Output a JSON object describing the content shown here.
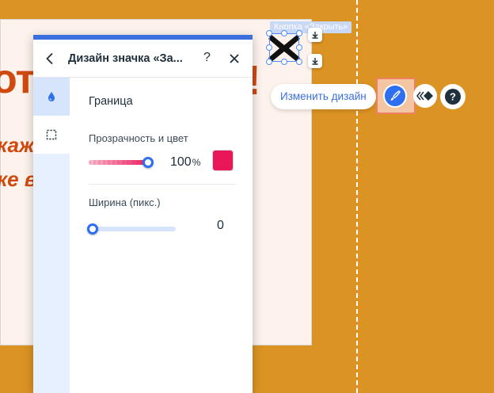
{
  "canvas": {
    "headline_fragment": "от",
    "headline_end": "!",
    "line1_fragment": "каж",
    "line2_fragment": "ке в"
  },
  "selected_element": {
    "tag_label": "Кнопка «Закрыть»"
  },
  "floating_toolbar": {
    "change_design_label": "Изменить дизайн",
    "help_label": "?"
  },
  "panel": {
    "title": "Дизайн значка «За...",
    "help_label": "?",
    "section_title": "Граница",
    "opacity": {
      "label": "Прозрачность и цвет",
      "value": "100",
      "unit": "%",
      "level": 1.0,
      "color": "#e9165a"
    },
    "width": {
      "label": "Ширина (пикс.)",
      "value": "0",
      "level": 0.0
    },
    "tabs": [
      {
        "icon": "fill-drop-icon",
        "active": true
      },
      {
        "icon": "border-dashed-icon",
        "active": false
      }
    ]
  },
  "colors": {
    "accent": "#3b6fe0",
    "canvas_bg": "#db9323",
    "headline": "#d04a10"
  }
}
